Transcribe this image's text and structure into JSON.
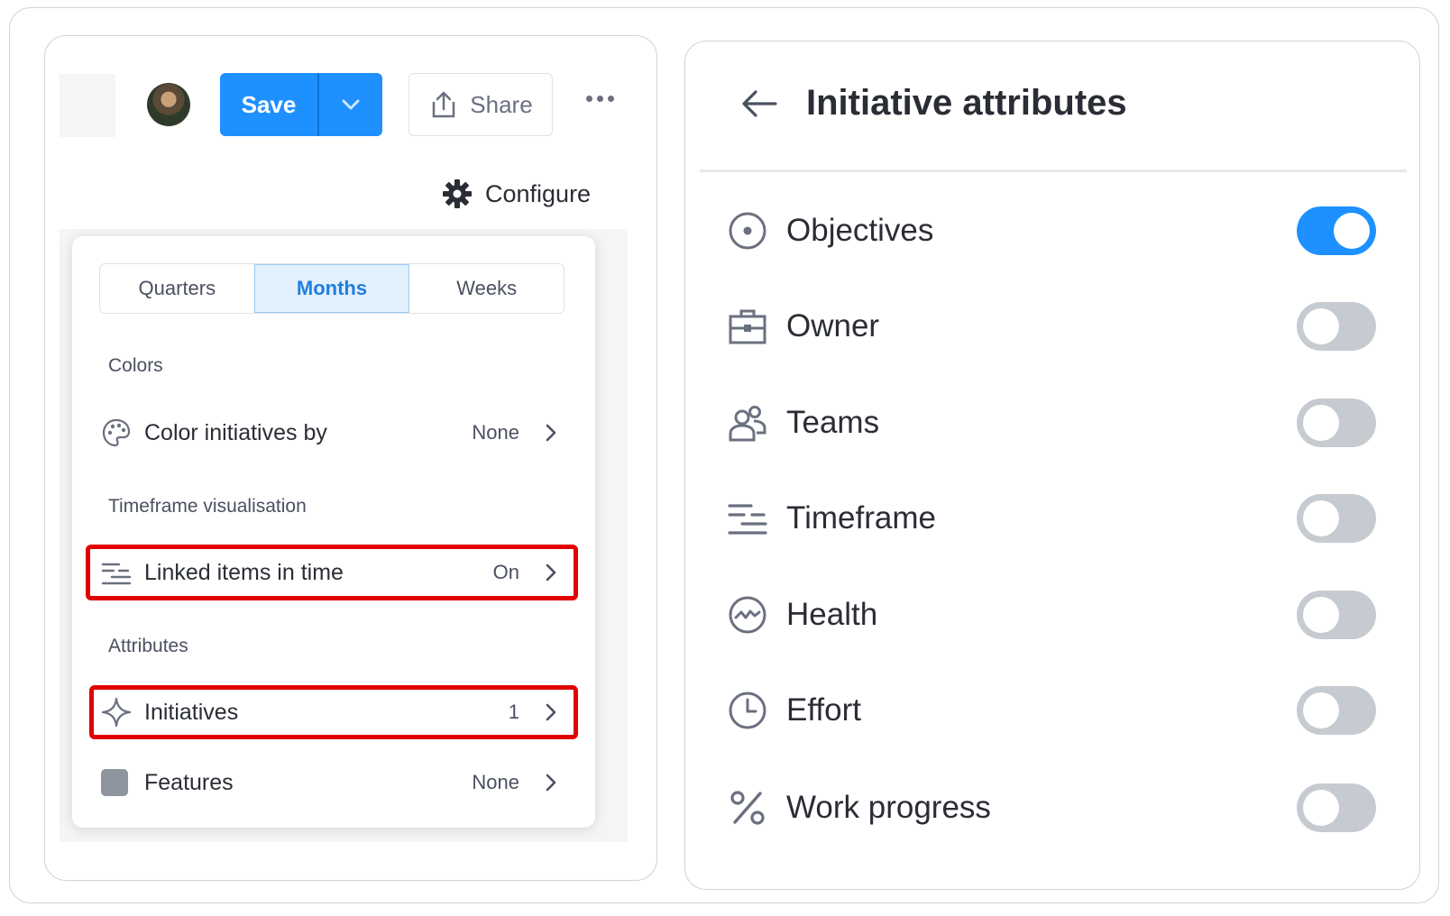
{
  "toolbar": {
    "save_label": "Save",
    "share_label": "Share",
    "configure_label": "Configure"
  },
  "popover": {
    "tabs": [
      "Quarters",
      "Months",
      "Weeks"
    ],
    "active_tab": "Months",
    "sections": {
      "colors": "Colors",
      "timeframe": "Timeframe visualisation",
      "attributes": "Attributes"
    },
    "rows": {
      "color_by": {
        "label": "Color initiatives by",
        "value": "None"
      },
      "linked_items": {
        "label": "Linked items in time",
        "value": "On"
      },
      "initiatives": {
        "label": "Initiatives",
        "value": "1"
      },
      "features": {
        "label": "Features",
        "value": "None"
      }
    }
  },
  "attributes_panel": {
    "title": "Initiative attributes",
    "items": [
      {
        "label": "Objectives",
        "icon": "target-icon",
        "on": true
      },
      {
        "label": "Owner",
        "icon": "briefcase-icon",
        "on": false
      },
      {
        "label": "Teams",
        "icon": "teams-icon",
        "on": false
      },
      {
        "label": "Timeframe",
        "icon": "timeframe-icon",
        "on": false
      },
      {
        "label": "Health",
        "icon": "health-icon",
        "on": false
      },
      {
        "label": "Effort",
        "icon": "clock-icon",
        "on": false
      },
      {
        "label": "Work progress",
        "icon": "percent-icon",
        "on": false
      }
    ]
  },
  "colors": {
    "accent": "#1e90ff",
    "highlight": "#e00000",
    "toggle_off": "#c6cbd1"
  }
}
